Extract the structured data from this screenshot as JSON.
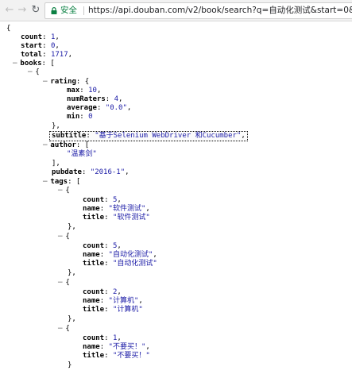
{
  "browser": {
    "back_icon": "arrow-left-icon",
    "forward_icon": "arrow-right-icon",
    "reload_icon": "reload-icon",
    "secure_label": "安全",
    "url": "https://api.douban.com/v2/book/search?q=自动化测试&start=0&count=1"
  },
  "json_view": {
    "open_brace": "{",
    "count_key": "count",
    "count_val": "1",
    "start_key": "start",
    "start_val": "0",
    "total_key": "total",
    "total_val": "1717",
    "books_key": "books",
    "rating_key": "rating",
    "max_key": "max",
    "max_val": "10",
    "numraters_key": "numRaters",
    "numraters_val": "4",
    "average_key": "average",
    "average_val": "\"0.0\"",
    "min_key": "min",
    "min_val": "0",
    "subtitle_key": "subtitle",
    "subtitle_val": "\"基于Selenium WebDriver 和Cucumber\"",
    "author_key": "author",
    "author_val": "\"温素剑\"",
    "pubdate_key": "pubdate",
    "pubdate_val": "\"2016-1\"",
    "tags_key": "tags",
    "tag_count_key": "count",
    "tag_name_key": "name",
    "tag_title_key": "title",
    "tags": [
      {
        "count": "5",
        "name": "\"软件测试\"",
        "title": "\"软件测试\""
      },
      {
        "count": "5",
        "name": "\"自动化测试\"",
        "title": "\"自动化测试\""
      },
      {
        "count": "2",
        "name": "\"计算机\"",
        "title": "\"计算机\""
      },
      {
        "count": "1",
        "name": "\"不要买！\"",
        "title": "\"不要买！\""
      }
    ]
  }
}
